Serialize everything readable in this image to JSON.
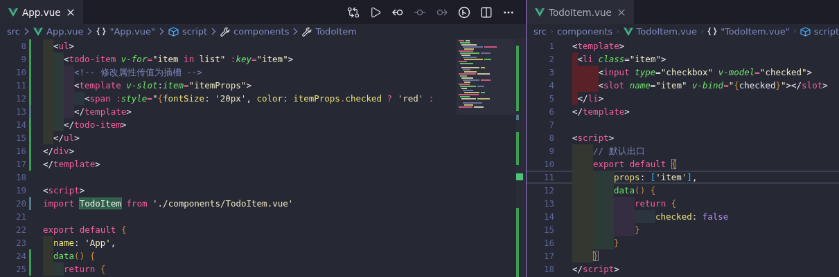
{
  "left": {
    "focused": true,
    "tab": {
      "label": "App.vue",
      "selected": true
    },
    "toolbar": [
      {
        "kind": "compare",
        "disabled": false
      },
      {
        "kind": "play",
        "disabled": false
      },
      {
        "kind": "previous",
        "disabled": false
      },
      {
        "kind": "commit",
        "disabled": true
      },
      {
        "kind": "next",
        "disabled": true
      },
      {
        "kind": "timeline",
        "disabled": false
      },
      {
        "kind": "split",
        "disabled": false
      },
      {
        "kind": "more",
        "disabled": false
      }
    ],
    "breadcrumbs": [
      {
        "kind": "folder",
        "text": "src"
      },
      {
        "kind": "vue",
        "text": "App.vue"
      },
      {
        "kind": "braces",
        "text": "\"App.vue\""
      },
      {
        "kind": "cube",
        "text": "script"
      },
      {
        "kind": "wrench",
        "text": "components"
      },
      {
        "kind": "wrench",
        "text": "TodoItem"
      }
    ],
    "lines": [
      {
        "number": "8",
        "added": true,
        "modified": false,
        "current": false,
        "tokens": [
          {
            "kind": "punct",
            "text": "  <"
          },
          {
            "kind": "tag",
            "text": "ul"
          },
          {
            "kind": "punct",
            "text": ">"
          }
        ]
      },
      {
        "number": "9",
        "added": true,
        "modified": false,
        "current": false,
        "tokens": [
          {
            "kind": "punct",
            "text": "    <"
          },
          {
            "kind": "tag",
            "text": "todo-item"
          },
          {
            "kind": "attr",
            "text": " v-for"
          },
          {
            "kind": "op",
            "text": "="
          },
          {
            "kind": "string",
            "text": "\"item "
          },
          {
            "kind": "keyword",
            "text": "in"
          },
          {
            "kind": "string",
            "text": " list\""
          },
          {
            "kind": "op",
            "text": " :"
          },
          {
            "kind": "attr",
            "text": "key"
          },
          {
            "kind": "op",
            "text": "="
          },
          {
            "kind": "string",
            "text": "\"item\""
          },
          {
            "kind": "punct",
            "text": ">"
          }
        ]
      },
      {
        "number": "10",
        "added": true,
        "modified": false,
        "current": false,
        "tokens": [
          {
            "kind": "comment",
            "text": "      <!-- 修改属性传值为插槽 -->"
          }
        ]
      },
      {
        "number": "11",
        "added": true,
        "modified": false,
        "current": false,
        "tokens": [
          {
            "kind": "punct",
            "text": "      <"
          },
          {
            "kind": "tag",
            "text": "template"
          },
          {
            "kind": "attr",
            "text": " v-slot"
          },
          {
            "kind": "punct",
            "text": ":"
          },
          {
            "kind": "attr",
            "text": "item"
          },
          {
            "kind": "op",
            "text": "="
          },
          {
            "kind": "string",
            "text": "\"itemProps\""
          },
          {
            "kind": "punct",
            "text": ">"
          }
        ]
      },
      {
        "number": "12",
        "added": true,
        "modified": false,
        "current": false,
        "tokens": [
          {
            "kind": "punct",
            "text": "        <"
          },
          {
            "kind": "tag",
            "text": "span"
          },
          {
            "kind": "op",
            "text": " :"
          },
          {
            "kind": "attr",
            "text": "style"
          },
          {
            "kind": "op",
            "text": "="
          },
          {
            "kind": "string",
            "text": "\""
          },
          {
            "kind": "bracket",
            "text": "{"
          },
          {
            "kind": "prop",
            "text": "fontSize"
          },
          {
            "kind": "punct",
            "text": ": "
          },
          {
            "kind": "string",
            "text": "'20px'"
          },
          {
            "kind": "punct",
            "text": ", "
          },
          {
            "kind": "prop",
            "text": "color"
          },
          {
            "kind": "punct",
            "text": ": "
          },
          {
            "kind": "prop",
            "text": "itemProps"
          },
          {
            "kind": "op",
            "text": "."
          },
          {
            "kind": "prop",
            "text": "checked"
          },
          {
            "kind": "op",
            "text": " ?"
          },
          {
            "kind": "string",
            "text": " 'red'"
          },
          {
            "kind": "op",
            "text": " :"
          }
        ]
      },
      {
        "number": "13",
        "added": false,
        "modified": true,
        "current": false,
        "tokens": [
          {
            "kind": "punct",
            "text": "      </"
          },
          {
            "kind": "tag",
            "text": "template"
          },
          {
            "kind": "punct",
            "text": ">"
          }
        ]
      },
      {
        "number": "14",
        "added": true,
        "modified": false,
        "current": false,
        "tokens": [
          {
            "kind": "punct",
            "text": "    </"
          },
          {
            "kind": "tag",
            "text": "todo-item"
          },
          {
            "kind": "punct",
            "text": ">"
          }
        ]
      },
      {
        "number": "15",
        "added": true,
        "modified": false,
        "current": false,
        "tokens": [
          {
            "kind": "punct",
            "text": "  </"
          },
          {
            "kind": "tag",
            "text": "ul"
          },
          {
            "kind": "punct",
            "text": ">"
          }
        ]
      },
      {
        "number": "16",
        "added": true,
        "modified": false,
        "current": false,
        "tokens": [
          {
            "kind": "punct",
            "text": "</"
          },
          {
            "kind": "tag",
            "text": "div"
          },
          {
            "kind": "punct",
            "text": ">"
          }
        ]
      },
      {
        "number": "17",
        "added": true,
        "modified": false,
        "current": false,
        "tokens": [
          {
            "kind": "punct",
            "text": "</"
          },
          {
            "kind": "tag",
            "text": "template"
          },
          {
            "kind": "punct",
            "text": ">"
          }
        ]
      },
      {
        "number": "18",
        "added": false,
        "modified": false,
        "current": false
      },
      {
        "number": "19",
        "added": false,
        "modified": false,
        "current": false,
        "tokens": [
          {
            "kind": "punct",
            "text": "<"
          },
          {
            "kind": "tag",
            "text": "script"
          },
          {
            "kind": "punct",
            "text": ">"
          }
        ]
      },
      {
        "number": "20",
        "added": false,
        "modified": true,
        "current": false,
        "tokens": [
          {
            "kind": "keyword",
            "text": "import "
          },
          {
            "kind": "match",
            "text": "TodoItem"
          },
          {
            "kind": "keyword",
            "text": " from"
          },
          {
            "kind": "string",
            "text": " './components/TodoItem.vue'"
          }
        ]
      },
      {
        "number": "21",
        "added": false,
        "modified": false,
        "current": false
      },
      {
        "number": "22",
        "added": false,
        "modified": false,
        "current": false,
        "tokens": [
          {
            "kind": "keyword",
            "text": "export default"
          },
          {
            "kind": "bracket",
            "text": " {"
          }
        ]
      },
      {
        "number": "23",
        "added": false,
        "modified": false,
        "current": false,
        "tokens": [
          {
            "kind": "prop",
            "text": "  name"
          },
          {
            "kind": "punct",
            "text": ": "
          },
          {
            "kind": "string",
            "text": "'App'"
          },
          {
            "kind": "punct",
            "text": ","
          }
        ]
      },
      {
        "number": "24",
        "added": true,
        "modified": false,
        "current": false,
        "tokens": [
          {
            "kind": "func",
            "text": "  data"
          },
          {
            "kind": "bracket",
            "text": "() {"
          }
        ]
      },
      {
        "number": "25",
        "added": true,
        "modified": false,
        "current": false,
        "tokens": [
          {
            "kind": "keyword",
            "text": "    return"
          },
          {
            "kind": "bracket",
            "text": " {"
          }
        ]
      }
    ]
  },
  "right": {
    "focused": false,
    "tab": {
      "label": "TodoItem.vue",
      "selected": true
    },
    "breadcrumbs": [
      {
        "kind": "folder",
        "text": "src"
      },
      {
        "kind": "folder",
        "text": "components"
      },
      {
        "kind": "vue",
        "text": "TodoItem.vue"
      },
      {
        "kind": "braces",
        "text": "\"TodoItem.vue\""
      },
      {
        "kind": "cube",
        "text": "script"
      }
    ],
    "lines": [
      {
        "number": "1",
        "current": false,
        "tokens": [
          {
            "kind": "punct",
            "text": "<"
          },
          {
            "kind": "tag",
            "text": "template"
          },
          {
            "kind": "punct",
            "text": ">"
          }
        ]
      },
      {
        "number": "2",
        "indent_error": true,
        "current": false,
        "tokens": [
          {
            "kind": "punct",
            "text": " <"
          },
          {
            "kind": "tag",
            "text": "li"
          },
          {
            "kind": "attr",
            "text": " class"
          },
          {
            "kind": "punct",
            "text": "="
          },
          {
            "kind": "string",
            "text": "\"item\""
          },
          {
            "kind": "punct",
            "text": ">"
          }
        ]
      },
      {
        "number": "3",
        "indent_error": true,
        "current": false,
        "tokens": [
          {
            "kind": "punct",
            "text": "     <"
          },
          {
            "kind": "tag",
            "text": "input"
          },
          {
            "kind": "attr",
            "text": " type"
          },
          {
            "kind": "punct",
            "text": "="
          },
          {
            "kind": "string",
            "text": "\"checkbox\""
          },
          {
            "kind": "attr",
            "text": " v-model"
          },
          {
            "kind": "op",
            "text": "="
          },
          {
            "kind": "string",
            "text": "\"checked\""
          },
          {
            "kind": "punct",
            "text": ">"
          }
        ]
      },
      {
        "number": "4",
        "indent_error": true,
        "current": false,
        "tokens": [
          {
            "kind": "punct",
            "text": "     <"
          },
          {
            "kind": "tag",
            "text": "slot"
          },
          {
            "kind": "attr",
            "text": " name"
          },
          {
            "kind": "punct",
            "text": "="
          },
          {
            "kind": "string",
            "text": "\"item\""
          },
          {
            "kind": "attr",
            "text": " v-bind"
          },
          {
            "kind": "op",
            "text": "="
          },
          {
            "kind": "string",
            "text": "\""
          },
          {
            "kind": "bracket",
            "text": "{"
          },
          {
            "kind": "plain",
            "text": "checked"
          },
          {
            "kind": "bracket",
            "text": "}"
          },
          {
            "kind": "string",
            "text": "\""
          },
          {
            "kind": "punct",
            "text": "></"
          },
          {
            "kind": "tag",
            "text": "slot"
          },
          {
            "kind": "punct",
            "text": ">"
          }
        ]
      },
      {
        "number": "5",
        "indent_error": true,
        "current": false,
        "tokens": [
          {
            "kind": "punct",
            "text": " </"
          },
          {
            "kind": "tag",
            "text": "li"
          },
          {
            "kind": "punct",
            "text": ">"
          }
        ]
      },
      {
        "number": "6",
        "current": false,
        "tokens": [
          {
            "kind": "punct",
            "text": "</"
          },
          {
            "kind": "tag",
            "text": "template"
          },
          {
            "kind": "punct",
            "text": ">"
          }
        ]
      },
      {
        "number": "7",
        "current": false
      },
      {
        "number": "8",
        "current": false,
        "tokens": [
          {
            "kind": "punct",
            "text": "<"
          },
          {
            "kind": "tag",
            "text": "script"
          },
          {
            "kind": "punct",
            "text": ">"
          }
        ]
      },
      {
        "number": "9",
        "current": false,
        "tokens": [
          {
            "kind": "comment",
            "text": "    // 默认出口"
          }
        ]
      },
      {
        "number": "10",
        "current": false,
        "tokens": [
          {
            "kind": "keyword",
            "text": "    export default "
          },
          {
            "kind": "bracket-match",
            "text": "{"
          }
        ]
      },
      {
        "number": "11",
        "current": true,
        "tokens": [
          {
            "kind": "prop",
            "text": "        props"
          },
          {
            "kind": "punct",
            "text": ": "
          },
          {
            "kind": "bracket2",
            "text": "["
          },
          {
            "kind": "string",
            "text": "'item'"
          },
          {
            "kind": "bracket2",
            "text": "]"
          },
          {
            "kind": "punct",
            "text": ","
          }
        ]
      },
      {
        "number": "12",
        "current": false,
        "tokens": [
          {
            "kind": "func",
            "text": "        data"
          },
          {
            "kind": "bracket",
            "text": "() {"
          }
        ]
      },
      {
        "number": "13",
        "current": false,
        "tokens": [
          {
            "kind": "keyword",
            "text": "            return"
          },
          {
            "kind": "bracket",
            "text": " {"
          }
        ]
      },
      {
        "number": "14",
        "current": false,
        "tokens": [
          {
            "kind": "prop",
            "text": "                checked"
          },
          {
            "kind": "punct",
            "text": ": "
          },
          {
            "kind": "boolean",
            "text": "false"
          }
        ]
      },
      {
        "number": "15",
        "current": false,
        "tokens": [
          {
            "kind": "bracket",
            "text": "            }"
          }
        ]
      },
      {
        "number": "16",
        "current": false,
        "tokens": [
          {
            "kind": "bracket",
            "text": "        }"
          }
        ]
      },
      {
        "number": "17",
        "current": false,
        "tokens": [
          {
            "kind": "bracket-match",
            "text": "    }"
          }
        ]
      },
      {
        "number": "18",
        "current": false,
        "tokens": [
          {
            "kind": "punct",
            "text": "</"
          },
          {
            "kind": "tag",
            "text": "script"
          },
          {
            "kind": "punct",
            "text": ">"
          }
        ]
      }
    ]
  }
}
